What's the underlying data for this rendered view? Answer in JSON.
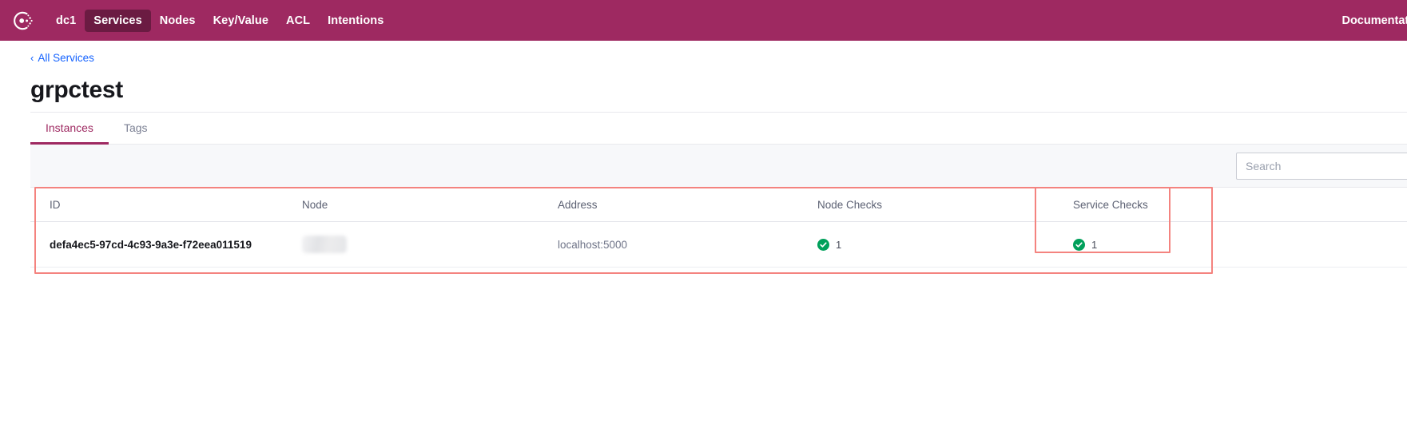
{
  "navbar": {
    "logo_icon": "consul-logo-icon",
    "datacenter": "dc1",
    "items": [
      {
        "label": "Services",
        "active": true
      },
      {
        "label": "Nodes",
        "active": false
      },
      {
        "label": "Key/Value",
        "active": false
      },
      {
        "label": "ACL",
        "active": false
      },
      {
        "label": "Intentions",
        "active": false
      }
    ],
    "documentation_label": "Documentation"
  },
  "breadcrumb": {
    "chevron_icon": "chevron-left-icon",
    "label": "All Services"
  },
  "page": {
    "title": "grpctest"
  },
  "tabs": [
    {
      "label": "Instances",
      "active": true
    },
    {
      "label": "Tags",
      "active": false
    }
  ],
  "search": {
    "value": "",
    "placeholder": "Search"
  },
  "table": {
    "columns": [
      "ID",
      "Node",
      "Address",
      "Node Checks",
      "Service Checks"
    ],
    "rows": [
      {
        "id": "defa4ec5-97cd-4c93-9a3e-f72eea011519",
        "node": "",
        "node_redacted": true,
        "address": "localhost:5000",
        "node_checks": {
          "icon": "check-circle-icon",
          "count": "1",
          "color": "#00a05b"
        },
        "service_checks": {
          "icon": "check-circle-icon",
          "count": "1",
          "color": "#00a05b"
        }
      }
    ]
  },
  "annotations": {
    "outer_label": "instances-table-highlight",
    "inner_label": "service-checks-column-highlight",
    "color": "#f4837f"
  },
  "colors": {
    "brand": "#9e2961",
    "brand_dark": "#6b1b42",
    "link": "#1563ff",
    "success": "#00a05b",
    "toolbar_bg": "#f7f8fa"
  }
}
